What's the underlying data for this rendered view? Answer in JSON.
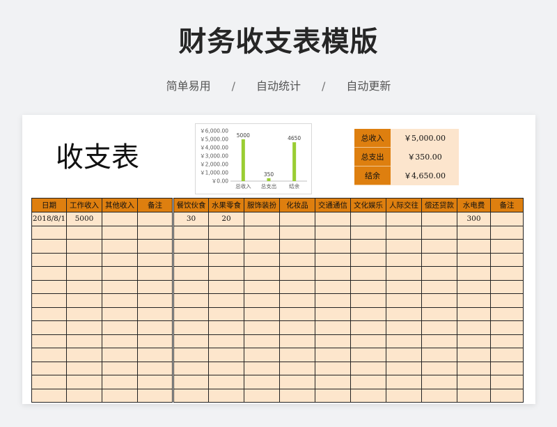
{
  "header": {
    "title": "财务收支表模版",
    "features": [
      "简单易用",
      "自动统计",
      "自动更新"
    ],
    "separator": "/"
  },
  "sheet": {
    "title": "收支表"
  },
  "summary": [
    {
      "label": "总收入",
      "value": "￥5,000.00"
    },
    {
      "label": "总支出",
      "value": "￥350.00"
    },
    {
      "label": "结余",
      "value": "￥4,650.00"
    }
  ],
  "chart_data": {
    "type": "bar",
    "categories": [
      "总收入",
      "总支出",
      "结余"
    ],
    "values": [
      5000,
      350,
      4650
    ],
    "data_labels": [
      "5000",
      "350",
      "4650"
    ],
    "y_ticks": [
      "￥0.00",
      "￥1,000.00",
      "￥2,000.00",
      "￥3,000.00",
      "￥4,000.00",
      "￥5,000.00",
      "￥6,000.00"
    ],
    "ylim": [
      0,
      6000
    ],
    "bar_color": "#9acd32",
    "grid": false
  },
  "ledger": {
    "columns": [
      "日期",
      "工作收入",
      "其他收入",
      "备注",
      "餐饮伙食",
      "水果零食",
      "服饰装扮",
      "化妆品",
      "交通通信",
      "文化娱乐",
      "人际交往",
      "偿还贷款",
      "水电费",
      "备注"
    ],
    "rows": [
      [
        "2018/8/1",
        "5000",
        "",
        "",
        "30",
        "20",
        "",
        "",
        "",
        "",
        "",
        "",
        "300",
        ""
      ]
    ],
    "empty_rows": 13
  },
  "colors": {
    "accent": "#de7f0f",
    "cell_fill": "#fde6cc",
    "page_bg": "#f1f2f4"
  }
}
